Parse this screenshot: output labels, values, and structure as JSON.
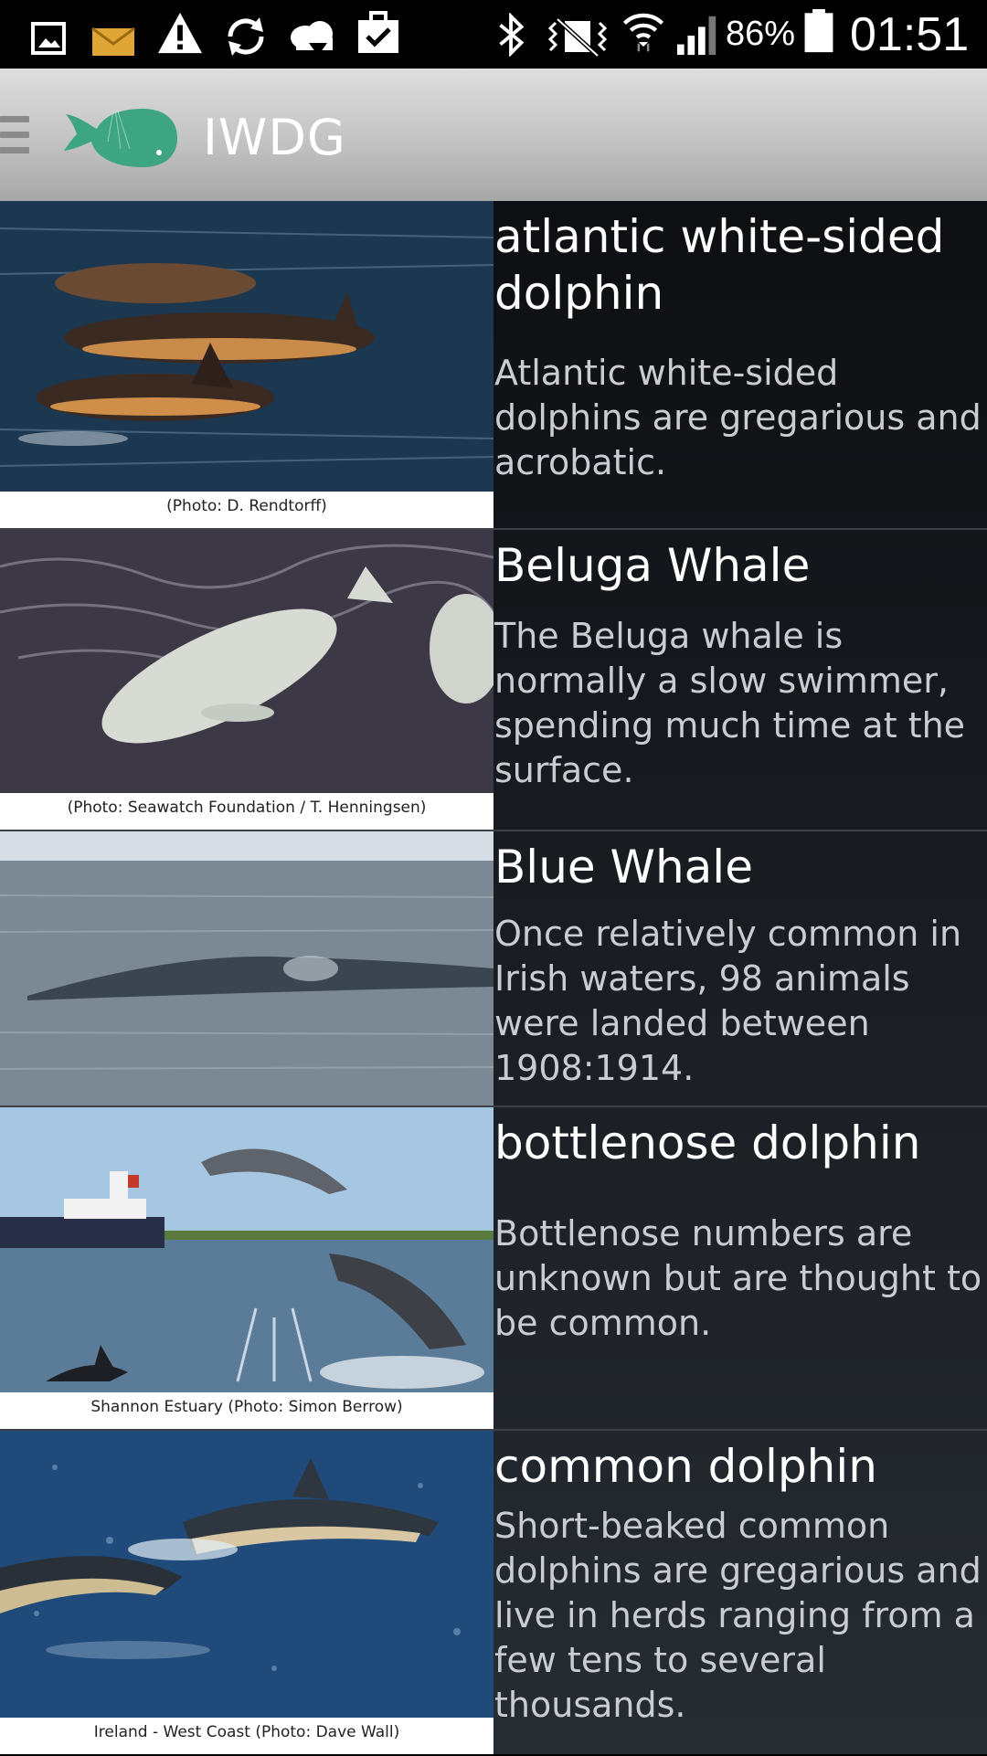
{
  "status_bar": {
    "battery": "86%",
    "time": "01:51",
    "icons": [
      "gallery-icon",
      "email-icon",
      "warning-icon",
      "sync-icon",
      "cloud-upload-icon",
      "task-icon",
      "bluetooth-icon",
      "vibrate-icon",
      "wifi-icon",
      "signal-icon",
      "battery-icon"
    ]
  },
  "action_bar": {
    "title": "IWDG",
    "logo": "whale-logo"
  },
  "species": [
    {
      "title": "atlantic white-sided dolphin",
      "description": "Atlantic white-sided dolphins are gregarious and acrobatic.",
      "caption": "(Photo: D. Rendtorff)"
    },
    {
      "title": "Beluga Whale",
      "description": "The Beluga whale is normally a slow swimmer, spending much time at the surface.",
      "caption": "(Photo: Seawatch Foundation / T. Henningsen)"
    },
    {
      "title": "Blue Whale",
      "description": "Once relatively common in Irish waters, 98 animals were landed between 1908:1914.",
      "caption": ""
    },
    {
      "title": "bottlenose dolphin",
      "description": "Bottlenose numbers are unknown but are thought to be common.",
      "caption": "Shannon Estuary (Photo: Simon Berrow)"
    },
    {
      "title": "common dolphin",
      "description": "Short-beaked common dolphins are gregarious and live in herds ranging from a few tens to several thousands.",
      "caption": "Ireland - West Coast (Photo: Dave Wall)"
    }
  ],
  "colors": {
    "status_bar": "#000000",
    "action_bar": "#c3c3c3",
    "logo": "#3ea583",
    "list_bg": "#15181c"
  }
}
